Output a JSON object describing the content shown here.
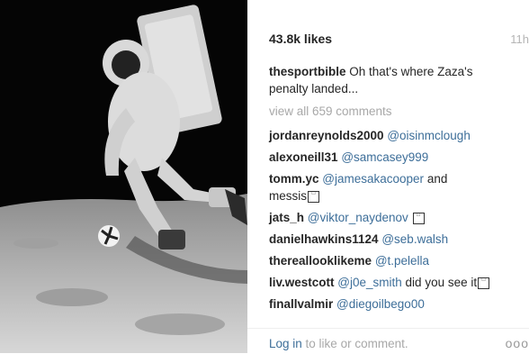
{
  "post": {
    "likes": "43.8k likes",
    "time": "11h",
    "caption_user": "thesportbible",
    "caption_text": "Oh that's where Zaza's penalty landed...",
    "view_all": "view all 659 comments"
  },
  "comments": [
    {
      "user": "jordanreynolds2000",
      "mention": "@oisinmclough",
      "text": ""
    },
    {
      "user": "alexoneill31",
      "mention": "@samcasey999",
      "text": ""
    },
    {
      "user": "tomm.yc",
      "mention": "@jamesakacooper",
      "text": "and messis"
    },
    {
      "user": "jats_h",
      "mention": "@viktor_naydenov",
      "text": ""
    },
    {
      "user": "danielhawkins1124",
      "mention": "@seb.walsh",
      "text": ""
    },
    {
      "user": "thereallooklikeme",
      "mention": "@t.pelella",
      "text": ""
    },
    {
      "user": "liv.westcott",
      "mention": "@j0e_smith",
      "text": "did you see it"
    },
    {
      "user": "finallvalmir",
      "mention": "@diegoilbego00",
      "text": ""
    }
  ],
  "footer": {
    "login_link": "Log in",
    "login_rest": " to like or comment.",
    "more": "ooo"
  },
  "icons": {
    "more": "ellipsis-icon",
    "emoji": "emoji-glyph-icon"
  }
}
